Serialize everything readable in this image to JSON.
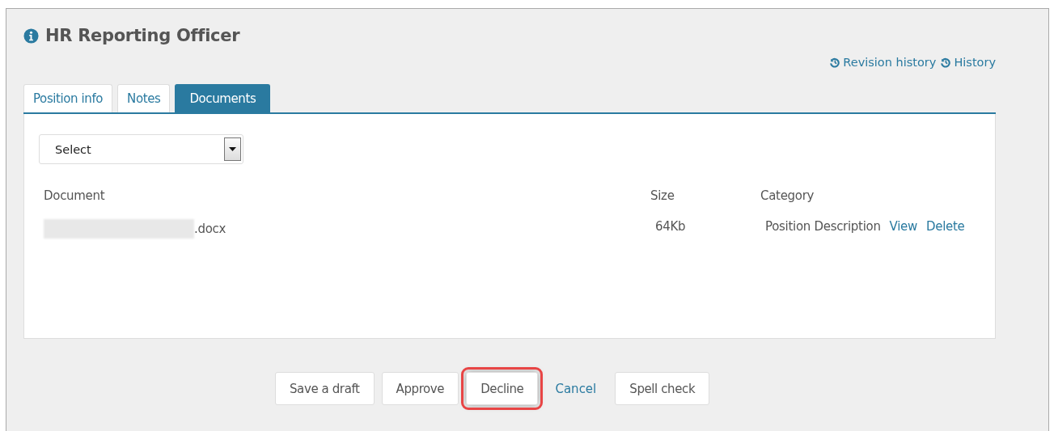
{
  "title": "HR Reporting Officer",
  "header_links": [
    {
      "label": "Revision history"
    },
    {
      "label": "History"
    }
  ],
  "tabs": [
    {
      "label": "Position info",
      "selected": false
    },
    {
      "label": "Notes",
      "selected": false
    },
    {
      "label": "Documents",
      "selected": true
    }
  ],
  "select": {
    "value": "Select"
  },
  "table": {
    "columns": [
      "Document",
      "Size",
      "Category"
    ],
    "rows": [
      {
        "document": ".docx",
        "name_redacted": true,
        "size": "64Kb",
        "category": "Position Description",
        "actions": [
          "View",
          "Delete"
        ]
      }
    ]
  },
  "buttons": [
    {
      "label": "Save a draft",
      "kind": "button",
      "highlighted": false
    },
    {
      "label": "Approve",
      "kind": "button",
      "highlighted": false
    },
    {
      "label": "Decline",
      "kind": "button",
      "highlighted": true
    },
    {
      "label": "Cancel",
      "kind": "link",
      "highlighted": false
    },
    {
      "label": "Spell check",
      "kind": "button",
      "highlighted": false
    }
  ]
}
